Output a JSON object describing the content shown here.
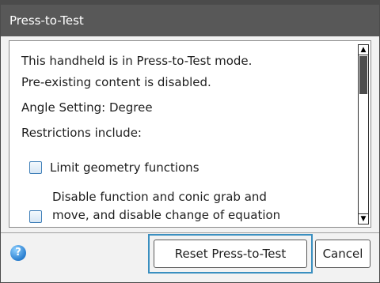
{
  "dialog": {
    "title": "Press-to-Test",
    "lines": [
      "This handheld is in Press-to-Test mode.",
      "Pre-existing content is disabled.",
      "Angle Setting: Degree",
      "Restrictions include:"
    ],
    "options": [
      {
        "label": "Limit geometry functions",
        "checked": false
      },
      {
        "label_line1": "Disable function and conic grab and",
        "label_line2": "move, and disable change of equation",
        "checked": false
      }
    ],
    "scroll_up": "▲",
    "scroll_down": "▼",
    "help": "?",
    "buttons": {
      "reset": "Reset Press-to-Test",
      "cancel": "Cancel"
    }
  },
  "colors": {
    "titlebar": "#585858",
    "focus": "#3a8fc0",
    "checkbox_border": "#3f7fb8"
  }
}
